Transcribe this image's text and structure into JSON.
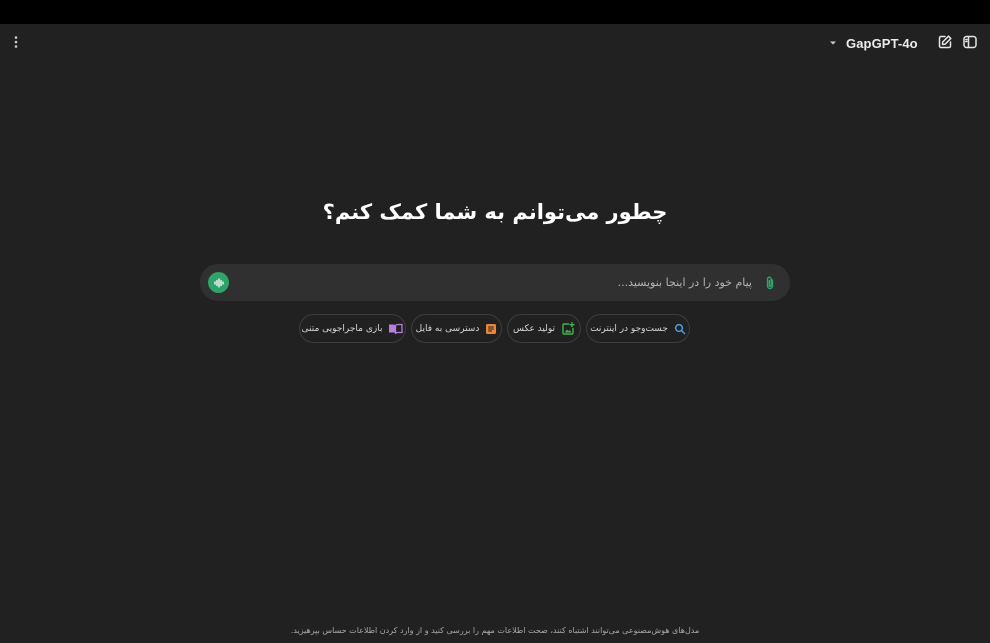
{
  "header": {
    "model_name": "GapGPT-4o",
    "icons": {
      "menu": "kebab-vertical-icon",
      "model_dropdown": "chevron-down-icon",
      "new_chat": "edit-icon",
      "sidebar": "sidebar-toggle-icon"
    }
  },
  "main": {
    "headline": "چطور می‌توانم به شما کمک کنم؟"
  },
  "composer": {
    "placeholder": "پیام خود را در اینجا بنویسید...",
    "value": "",
    "voice_icon": "voice-waveform-icon",
    "attach_icon": "paperclip-icon"
  },
  "suggestions": [
    {
      "label": "جست‌وجو در اینترنت",
      "icon": "search-icon",
      "color": "#4f9de0"
    },
    {
      "label": "تولید عکس",
      "icon": "image-add-icon",
      "color": "#3fb54e"
    },
    {
      "label": "دسترسی به فایل",
      "icon": "document-icon",
      "color": "#e8873a"
    },
    {
      "label": "بازی ماجراجویی متنی",
      "icon": "book-open-icon",
      "color": "#b77de0"
    }
  ],
  "footer": {
    "disclaimer": "مدل‌های هوش‌مصنوعی می‌توانند اشتباه کنند، صحت اطلاعات مهم را بررسی کنید و از وارد کردن اطلاعات حساس بپرهیزید."
  },
  "colors": {
    "background": "#212121",
    "top_strip": "#000000",
    "composer_bg": "#303030",
    "voice_button": "#2fa369",
    "attach_icon": "#2fa369"
  }
}
